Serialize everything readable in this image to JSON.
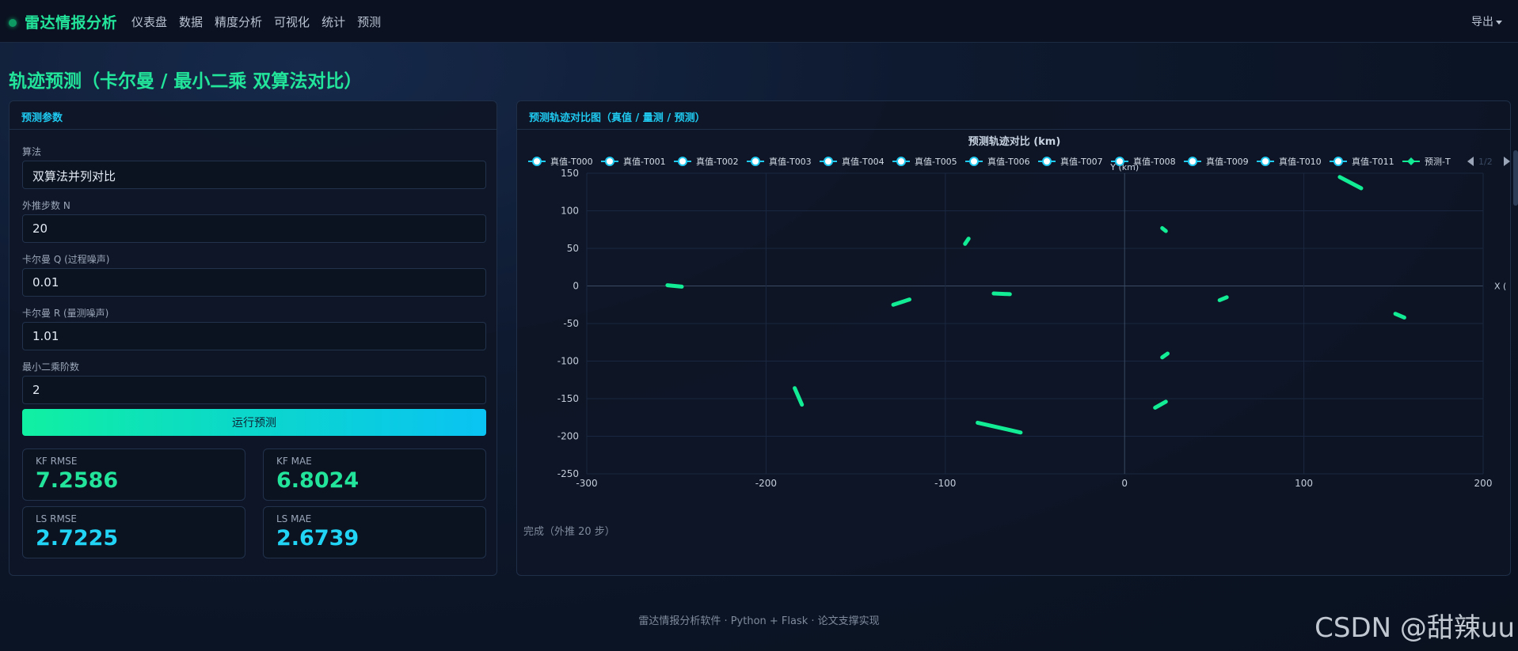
{
  "navbar": {
    "brand": "雷达情报分析",
    "links": [
      "仪表盘",
      "数据",
      "精度分析",
      "可视化",
      "统计",
      "预测"
    ],
    "export_label": "导出"
  },
  "page_title": "轨迹预测（卡尔曼 / 最小二乘 双算法对比）",
  "params": {
    "header": "预测参数",
    "algorithm_label": "算法",
    "algorithm_value": "双算法并列对比",
    "steps_label": "外推步数 N",
    "steps_value": "20",
    "kf_q_label": "卡尔曼 Q (过程噪声)",
    "kf_q_value": "0.01",
    "kf_r_label": "卡尔曼 R (量测噪声)",
    "kf_r_value": "1.01",
    "ls_order_label": "最小二乘阶数",
    "ls_order_value": "2",
    "run_button": "运行预测"
  },
  "metrics": {
    "kf_rmse_label": "KF RMSE",
    "kf_rmse": "7.2586",
    "kf_mae_label": "KF MAE",
    "kf_mae": "6.8024",
    "ls_rmse_label": "LS RMSE",
    "ls_rmse": "2.7225",
    "ls_mae_label": "LS MAE",
    "ls_mae": "2.6739"
  },
  "chart_panel": {
    "header": "预测轨迹对比图（真值 / 量测 / 预测）",
    "status": "完成（外推 20 步）",
    "pager": "1/2"
  },
  "chart_data": {
    "type": "line",
    "title": "预测轨迹对比 (km)",
    "xlabel": "X (",
    "ylabel": "Y (km)",
    "xlim": [
      -300,
      200
    ],
    "ylim": [
      -250,
      150
    ],
    "xticks": [
      -300,
      -200,
      -100,
      0,
      100,
      200
    ],
    "yticks": [
      150,
      100,
      50,
      0,
      -50,
      -100,
      -150,
      -200,
      -250
    ],
    "grid": true,
    "legend_position": "top",
    "legend": [
      "真值-T000",
      "真值-T001",
      "真值-T002",
      "真值-T003",
      "真值-T004",
      "真值-T005",
      "真值-T006",
      "真值-T007",
      "真值-T008",
      "真值-T009",
      "真值-T010",
      "真值-T011",
      "预测-T"
    ],
    "series": [
      {
        "points": [
          [
            -255,
            1
          ],
          [
            -247,
            -1
          ]
        ]
      },
      {
        "points": [
          [
            -129,
            -25
          ],
          [
            -120,
            -18
          ]
        ]
      },
      {
        "points": [
          [
            -89,
            56
          ],
          [
            -87,
            63
          ]
        ]
      },
      {
        "points": [
          [
            -73,
            -10
          ],
          [
            -64,
            -11
          ]
        ]
      },
      {
        "points": [
          [
            -184,
            -136
          ],
          [
            -180,
            -158
          ]
        ]
      },
      {
        "points": [
          [
            -82,
            -182
          ],
          [
            -58,
            -195
          ]
        ]
      },
      {
        "points": [
          [
            21,
            77
          ],
          [
            23,
            73
          ]
        ]
      },
      {
        "points": [
          [
            53,
            -19
          ],
          [
            57,
            -15
          ]
        ]
      },
      {
        "points": [
          [
            21,
            -95
          ],
          [
            24,
            -90
          ]
        ]
      },
      {
        "points": [
          [
            17,
            -162
          ],
          [
            23,
            -154
          ]
        ]
      },
      {
        "points": [
          [
            120,
            145
          ],
          [
            132,
            130
          ]
        ]
      },
      {
        "points": [
          [
            151,
            -37
          ],
          [
            156,
            -42
          ]
        ]
      }
    ],
    "colors": {
      "trajectory": "#12ec95",
      "legend_ring": "#1fc9f0"
    }
  },
  "footer": "雷达情报分析软件 · Python + Flask · 论文支撑实现",
  "watermark": "CSDN @甜辣uu"
}
